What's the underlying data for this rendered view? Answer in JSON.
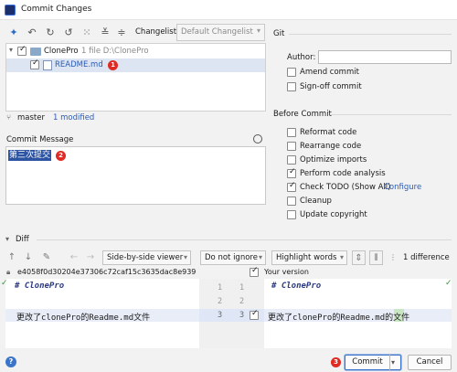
{
  "window": {
    "title": "Commit Changes"
  },
  "toolbar": {
    "changelist_label": "Changelist:",
    "changelist_value": "Default Changelist"
  },
  "tree": {
    "root": {
      "name": "ClonePro",
      "meta": "1 file  D:\\ClonePro"
    },
    "file": {
      "name": "README.md"
    },
    "badge1": "1"
  },
  "status": {
    "branch": "master",
    "modified": "1 modified"
  },
  "commit_message": {
    "label": "Commit Message",
    "text": "第三次提交",
    "badge": "2"
  },
  "git": {
    "heading": "Git",
    "author_label": "Author:",
    "author_value": "",
    "amend": "Amend commit",
    "signoff": "Sign-off commit"
  },
  "before_commit": {
    "heading": "Before Commit",
    "options": [
      {
        "label": "Reformat code",
        "checked": false
      },
      {
        "label": "Rearrange code",
        "checked": false
      },
      {
        "label": "Optimize imports",
        "checked": false
      },
      {
        "label": "Perform code analysis",
        "checked": true
      },
      {
        "label": "Check TODO (Show All)",
        "checked": true,
        "link": "Configure"
      },
      {
        "label": "Cleanup",
        "checked": false
      },
      {
        "label": "Update copyright",
        "checked": false
      }
    ]
  },
  "diff": {
    "heading": "Diff",
    "viewer": "Side-by-side viewer",
    "ignore": "Do not ignore",
    "highlight": "Highlight words",
    "count": "1 difference",
    "hash": "e4058f0d30204e37306c72caf15c3635dac8e939",
    "your_version": "Your version",
    "left_lines": [
      "# ClonePro",
      "",
      "更改了clonePro的Readme.md文件"
    ],
    "right_lines": [
      "# ClonePro",
      "",
      "更改了clonePro的Readme.md的文件"
    ],
    "line_numbers": [
      "1",
      "2",
      "3"
    ]
  },
  "footer": {
    "commit": "Commit",
    "cancel": "Cancel",
    "badge3": "3",
    "help": "?"
  },
  "colors": {
    "accent": "#2b5bb5",
    "badge": "#e02a24",
    "selection": "#2c54a3"
  }
}
